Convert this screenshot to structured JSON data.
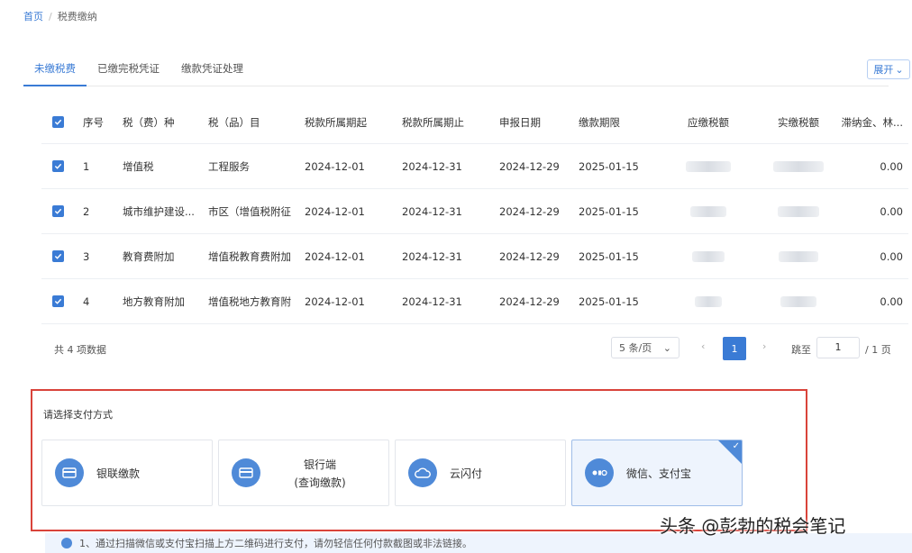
{
  "breadcrumb": {
    "home": "首页",
    "separator": "/",
    "current": "税费缴纳"
  },
  "tabs": [
    {
      "label": "未缴税费",
      "active": true
    },
    {
      "label": "已缴完税凭证",
      "active": false
    },
    {
      "label": "缴款凭证处理",
      "active": false
    }
  ],
  "expand_button": "展开",
  "table": {
    "columns": [
      "序号",
      "税（费）种",
      "税（品）目",
      "税款所属期起",
      "税款所属期止",
      "申报日期",
      "缴款期限",
      "应缴税额",
      "实缴税额",
      "滞纳金、林..."
    ],
    "rows": [
      {
        "no": "1",
        "tax": "增值税",
        "item": "工程服务",
        "start": "2024-12-01",
        "end": "2024-12-31",
        "decl": "2024-12-29",
        "due": "2025-01-15",
        "late": "0.00"
      },
      {
        "no": "2",
        "tax": "城市维护建设...",
        "item": "市区（增值税附征",
        "start": "2024-12-01",
        "end": "2024-12-31",
        "decl": "2024-12-29",
        "due": "2025-01-15",
        "late": "0.00"
      },
      {
        "no": "3",
        "tax": "教育费附加",
        "item": "增值税教育费附加",
        "start": "2024-12-01",
        "end": "2024-12-31",
        "decl": "2024-12-29",
        "due": "2025-01-15",
        "late": "0.00"
      },
      {
        "no": "4",
        "tax": "地方教育附加",
        "item": "增值税地方教育附",
        "start": "2024-12-01",
        "end": "2024-12-31",
        "decl": "2024-12-29",
        "due": "2025-01-15",
        "late": "0.00"
      }
    ]
  },
  "pagination": {
    "total": "共 4 项数据",
    "page_size": "5 条/页",
    "current_page": "1",
    "jump_label": "跳至",
    "jump_value": "1",
    "pages_total": "/ 1 页"
  },
  "payment": {
    "title": "请选择支付方式",
    "methods": [
      {
        "label": "银联缴款",
        "icon": "card-icon",
        "selected": false
      },
      {
        "label": "银行端",
        "sublabel": "(查询缴款)",
        "icon": "bank-card-icon",
        "selected": false
      },
      {
        "label": "云闪付",
        "icon": "cloud-icon",
        "selected": false
      },
      {
        "label": "微信、支付宝",
        "icon": "qr-pay-icon",
        "selected": true
      }
    ]
  },
  "notice": "1、通过扫描微信或支付宝扫描上方二维码进行支付，请勿轻信任何付款截图或非法链接。",
  "watermark": "头条 @彭勃的税会笔记",
  "colors": {
    "accent": "#3a7bd5",
    "highlight_border": "#d9433a"
  }
}
